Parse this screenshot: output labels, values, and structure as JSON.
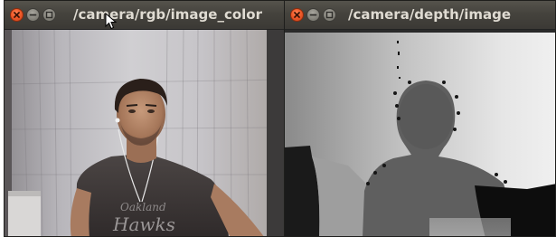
{
  "windows": [
    {
      "title": "/camera/rgb/image_color",
      "buttons": [
        "close-icon",
        "minimize-icon",
        "maximize-icon"
      ]
    },
    {
      "title": "/camera/depth/image",
      "buttons": [
        "close-icon",
        "minimize-icon",
        "maximize-icon"
      ]
    }
  ],
  "colors": {
    "titlebar": "#45433d",
    "title_text": "#dfdbd2",
    "close_button": "#f05a2a"
  }
}
